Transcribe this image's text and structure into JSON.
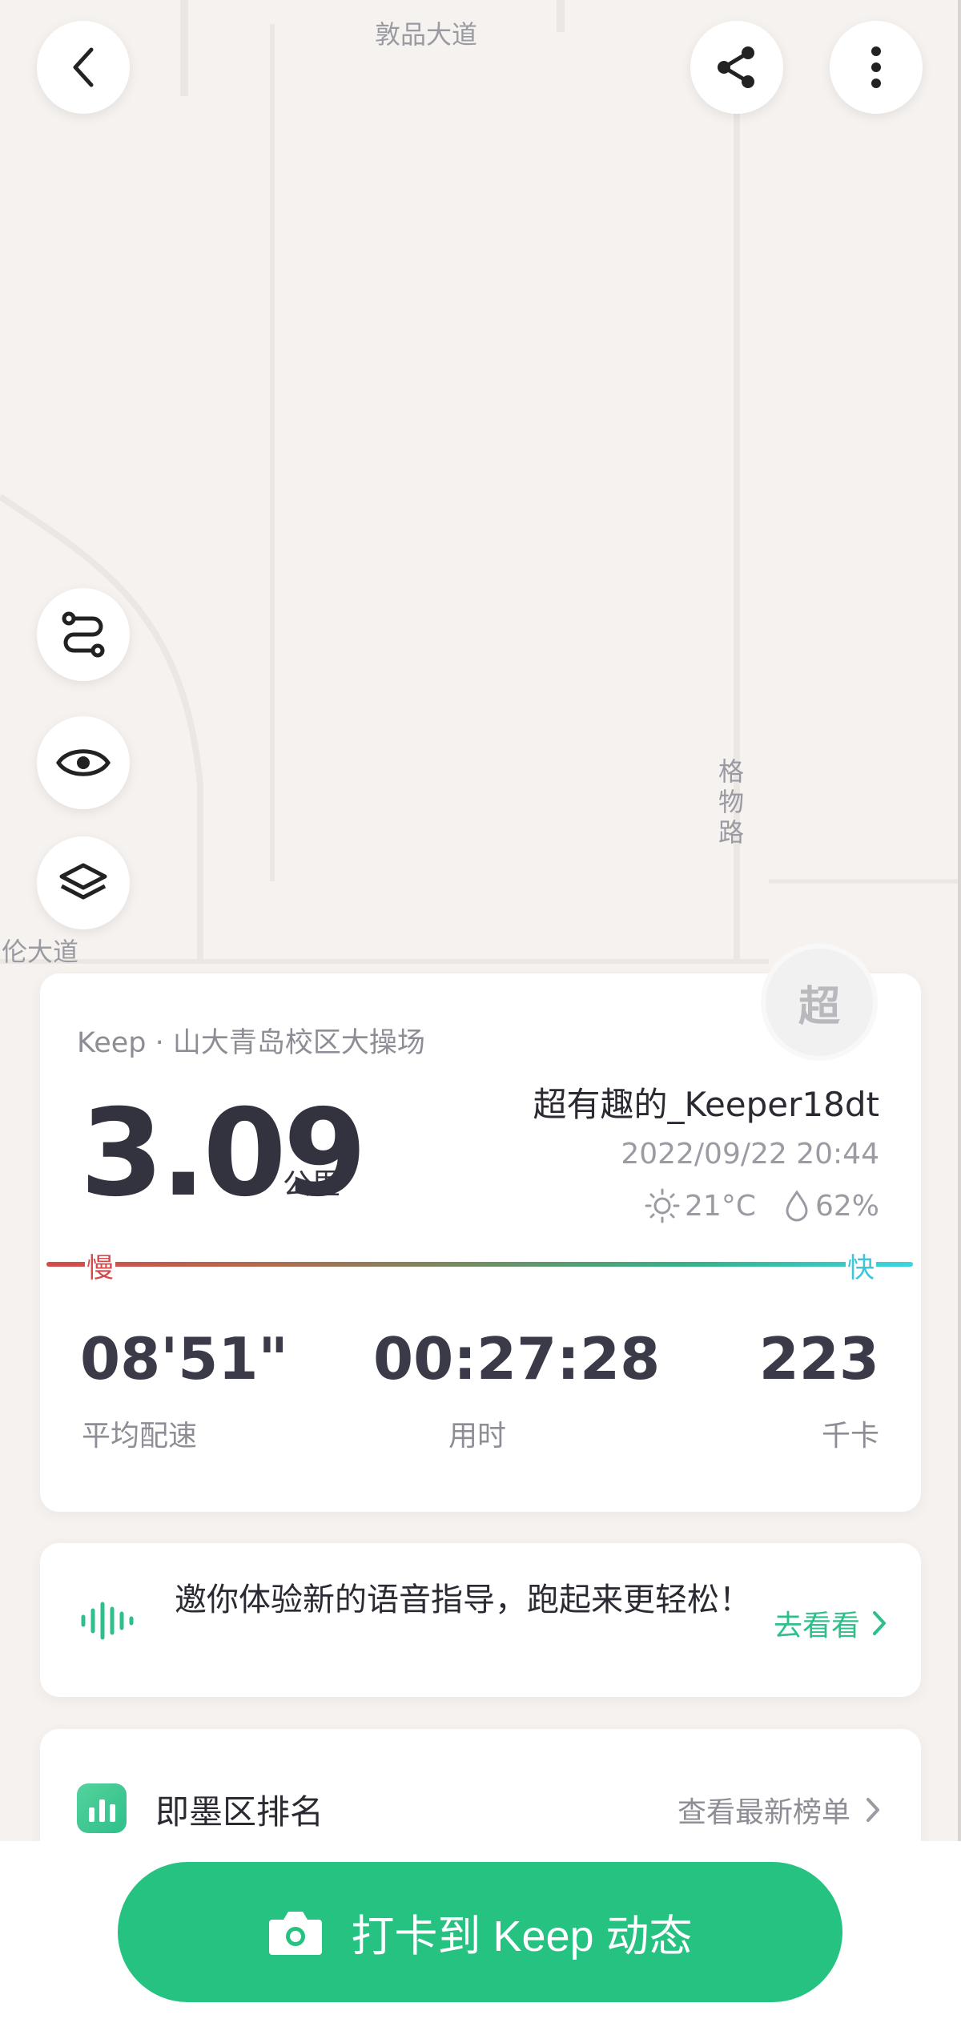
{
  "map": {
    "road_top": "敦品大道",
    "road_right": "格物路",
    "road_left": "明伦大道"
  },
  "summary": {
    "avatar_text": "超",
    "location": "Keep · 山大青岛校区大操场",
    "distance": "3.09",
    "distance_unit": "公里",
    "username": "超有趣的_Keeper18dt",
    "datetime": "2022/09/22 20:44",
    "temperature": "21°C",
    "humidity": "62%",
    "pace_slow_label": "慢",
    "pace_fast_label": "快",
    "stats": {
      "avg_pace": "08'51\"",
      "avg_pace_label": "平均配速",
      "duration": "00:27:28",
      "duration_label": "用时",
      "calories": "223",
      "calories_label": "千卡"
    }
  },
  "voice_promo": {
    "text": "邀你体验新的语音指导，跑起来更轻松！",
    "link": "去看看"
  },
  "ranking": {
    "title": "即墨区排名",
    "link": "查看最新榜单"
  },
  "checkin": {
    "label": "打卡到 Keep 动态"
  },
  "colors": {
    "brand_green": "#25c281",
    "pace_slow": "#d44a4a",
    "pace_fast": "#3cc6d8"
  }
}
